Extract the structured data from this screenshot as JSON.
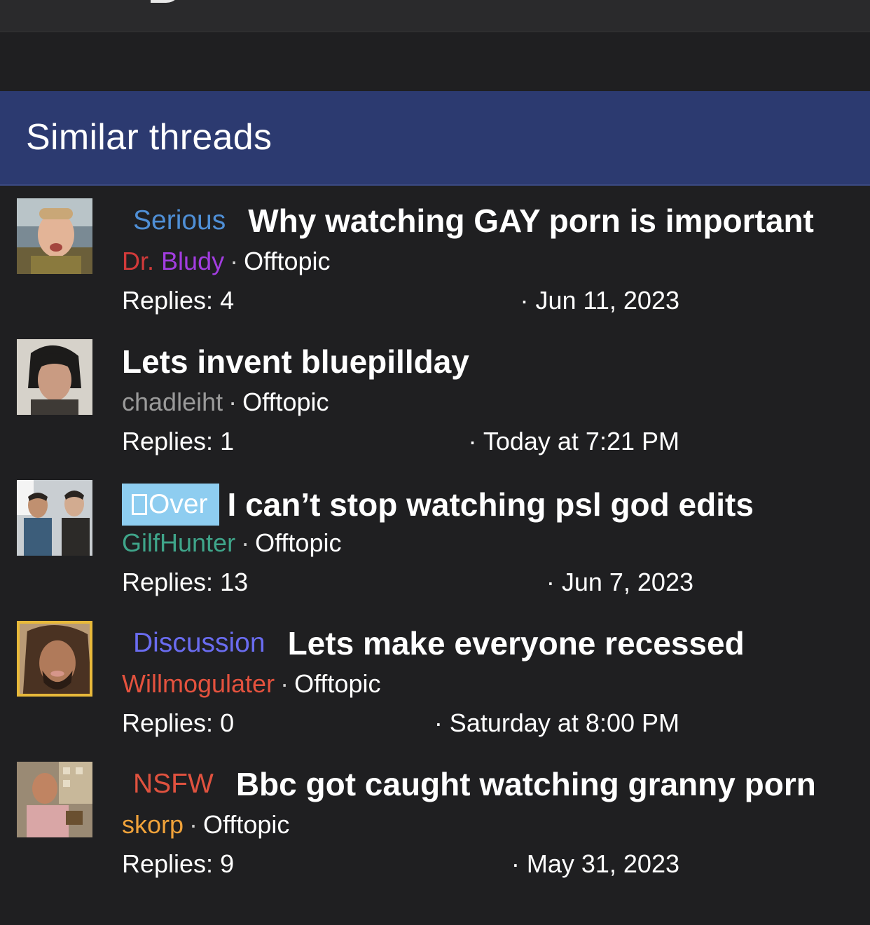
{
  "section": {
    "title": "Similar threads"
  },
  "threads": [
    {
      "prefix": "Serious",
      "title": "Why watching GAY porn is important",
      "author_part1": "Dr.",
      "author_part2": "Bludy",
      "separator": "·",
      "forum": "Offtopic",
      "replies": "Replies: 4",
      "date": "· Jun 11, 2023",
      "avatar_icon": "user-avatar-photo"
    },
    {
      "prefix": "",
      "title": "Lets invent bluepillday",
      "author": "chadleiht",
      "separator": "·",
      "forum": "Offtopic",
      "replies": "Replies: 1",
      "date": "· Today at 7:21 PM",
      "avatar_icon": "user-avatar-photo"
    },
    {
      "prefix": "Over",
      "title": "I can’t stop watching psl god edits",
      "author": "GilfHunter",
      "separator": "·",
      "forum": "Offtopic",
      "replies": "Replies: 13",
      "date": "· Jun 7, 2023",
      "avatar_icon": "user-avatar-photo"
    },
    {
      "prefix": "Discussion",
      "title": "Lets make everyone recessed",
      "author": "Willmogulater",
      "separator": "·",
      "forum": "Offtopic",
      "replies": "Replies: 0",
      "date": "· Saturday at 8:00 PM",
      "avatar_icon": "user-avatar-photo"
    },
    {
      "prefix": "NSFW",
      "title": "Bbc got caught watching granny porn",
      "author": "skorp",
      "separator": "·",
      "forum": "Offtopic",
      "replies": "Replies: 9",
      "date": "· May 31, 2023",
      "avatar_icon": "user-avatar-photo"
    }
  ],
  "colors": {
    "background": "#1f1f21",
    "section_header": "#2c3a70",
    "prefix_serious": "#4f8fd6",
    "prefix_discussion": "#6a6cf0",
    "prefix_nsfw": "#e0523f",
    "prefix_over_bg": "#8ecdf0"
  }
}
